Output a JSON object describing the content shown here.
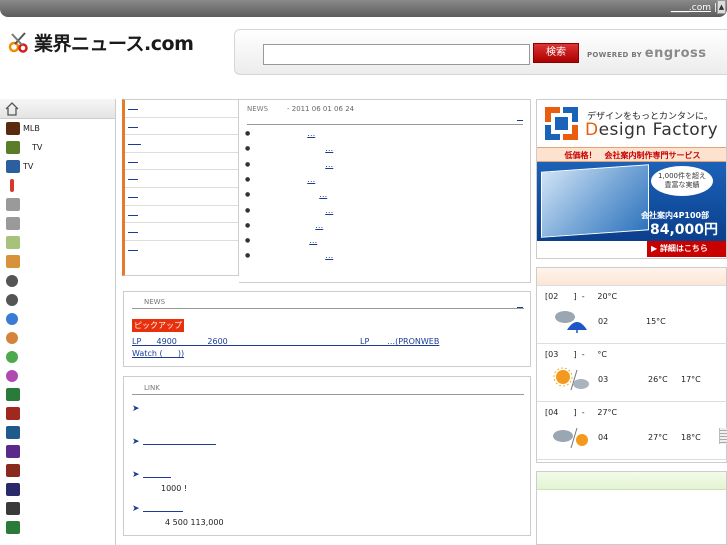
{
  "topbar": {
    "link_label": "____.com",
    "separator": "|",
    "scroll_glyph": "▲"
  },
  "header": {
    "logo_text": "業界ニュース.com",
    "search_placeholder": "",
    "search_button": "検索",
    "powered_by": "POWERED BY",
    "powered_brand": "engross"
  },
  "sidebar": {
    "items": [
      {
        "label": "MLB",
        "icon": "baseball-icon",
        "color": "#5a2a10"
      },
      {
        "label": "TV",
        "icon": "tv-icon",
        "color": "#5a7d2a"
      },
      {
        "label": "TV",
        "icon": "tv-icon",
        "color": "#2b5f9e"
      },
      {
        "label": "",
        "icon": "pin-icon",
        "color": "#d23a2a"
      },
      {
        "label": "",
        "icon": "people-icon",
        "color": "#9a9a9a"
      },
      {
        "label": "",
        "icon": "people-icon",
        "color": "#9a9a9a"
      },
      {
        "label": "",
        "icon": "figure-icon",
        "color": "#a7c27a"
      },
      {
        "label": "",
        "icon": "house-icon",
        "color": "#d8923a"
      },
      {
        "label": "",
        "icon": "car-icon",
        "color": "#555555"
      },
      {
        "label": "",
        "icon": "car-icon",
        "color": "#555555"
      },
      {
        "label": "",
        "icon": "globe-icon",
        "color": "#3a7bd5"
      },
      {
        "label": "",
        "icon": "globe-icon",
        "color": "#d5833a"
      },
      {
        "label": "",
        "icon": "globe-icon",
        "color": "#4caa4c"
      },
      {
        "label": "",
        "icon": "globe-icon",
        "color": "#b04ab0"
      },
      {
        "label": "",
        "icon": "monitor-icon",
        "color": "#2a7a3a"
      },
      {
        "label": "",
        "icon": "monitor-icon",
        "color": "#a0281e"
      },
      {
        "label": "",
        "icon": "monitor-icon",
        "color": "#1f5a8a"
      },
      {
        "label": "",
        "icon": "monitor-icon",
        "color": "#5a2a8a"
      },
      {
        "label": "",
        "icon": "monitor-icon",
        "color": "#8a2a1e"
      },
      {
        "label": "",
        "icon": "monitor-icon",
        "color": "#2a2a6a"
      },
      {
        "label": "",
        "icon": "monitor-icon",
        "color": "#3a3a3a"
      },
      {
        "label": "",
        "icon": "monitor-icon",
        "color": "#2a7a3a"
      }
    ]
  },
  "category_nav": {
    "rows": 9
  },
  "news": {
    "heading": "NEWS",
    "date": "- 2011 06 01  06 24",
    "items": [
      "…",
      "…",
      "…",
      "…",
      "…",
      "…",
      "…",
      "…",
      "…"
    ]
  },
  "pickup": {
    "heading": "NEWS",
    "badge": "ピックアップ",
    "text": "LP      4900            2600                                                    LP       …(PRONWEB\nWatch (      ))"
  },
  "links": {
    "heading": "LINK",
    "arrow": "➤",
    "note1": "1000   !",
    "note2": "4   500 113,000"
  },
  "ad": {
    "tagline": "デザインをもっとカンタンに。",
    "brand_d": "D",
    "brand_rest": "esign Factory",
    "strip": "低価格！　会社案内制作専門サービス",
    "bubble": "1,000件を超え\n豊富な実績",
    "price_note": "会社案内4P100部",
    "price": "84,000円",
    "details": "▶ 詳細はこちら",
    "accent": "#e85d0e",
    "brand_blue": "#1a63b8"
  },
  "weather": {
    "days": [
      {
        "title": "[02      ]  -     20°C",
        "num": "02",
        "hi": "15°C",
        "lo": "",
        "icon": "rain-umbrella-icon"
      },
      {
        "title": "[03      ]  -     °C",
        "num": "03",
        "hi": "26°C",
        "lo": "17°C",
        "icon": "sun-cloud-icon"
      },
      {
        "title": "[04      ]  -     27°C",
        "num": "04",
        "hi": "27°C",
        "lo": "18°C",
        "icon": "cloud-sun-icon"
      }
    ]
  }
}
